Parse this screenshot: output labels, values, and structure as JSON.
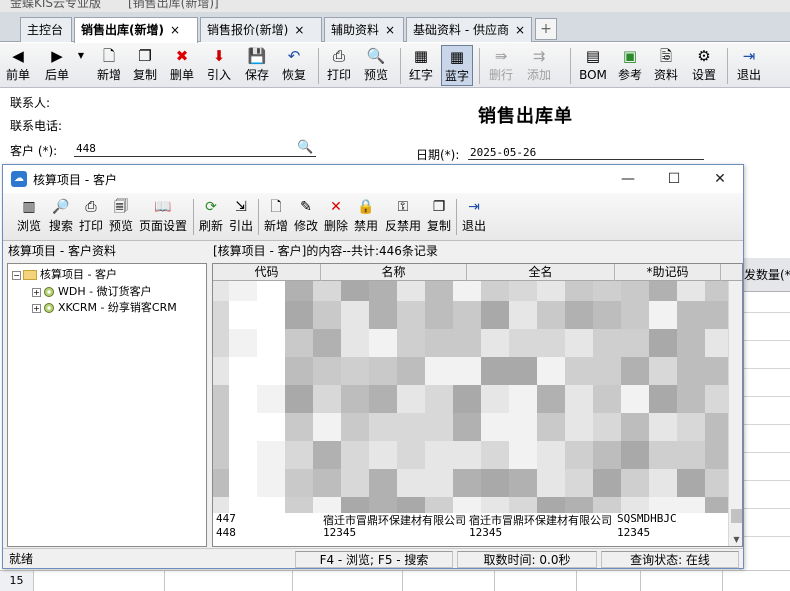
{
  "app": {
    "title_product": "金蝶KIS云专业版",
    "title_doc": "[销售出库(新增)]"
  },
  "tabs": [
    {
      "label": "主控台",
      "close": ""
    },
    {
      "label": "销售出库(新增)",
      "close": "×"
    },
    {
      "label": "销售报价(新增)",
      "close": "×"
    },
    {
      "label": "辅助资料",
      "close": "×"
    },
    {
      "label": "基础资料 - 供应商",
      "close": "×"
    }
  ],
  "tab_add": "+",
  "toolbar": {
    "prev": "前单",
    "next": "后单",
    "new": "新增",
    "copy": "复制",
    "delete": "删单",
    "import": "引入",
    "save": "保存",
    "restore": "恢复",
    "print": "打印",
    "preview": "预览",
    "red": "红字",
    "blue": "蓝字",
    "delrow": "删行",
    "addrow": "添加",
    "bom": "BOM",
    "ref": "参考",
    "data": "资料",
    "settings": "设置",
    "exit": "退出"
  },
  "form": {
    "title": "销售出库单",
    "contact_label": "联系人:",
    "phone_label": "联系电话:",
    "customer_label": "客户 (*):",
    "customer_value": "448",
    "date_label": "日期(*):",
    "date_value": "2025-05-26",
    "grid_col_partial": "发数量(*"
  },
  "bottom_row_number": "15",
  "dialog": {
    "title": "核算项目 - 客户",
    "min": "—",
    "max": "☐",
    "close": "✕",
    "toolbar": {
      "browse": "浏览",
      "search": "搜索",
      "print": "打印",
      "preview": "预览",
      "page_setup": "页面设置",
      "refresh": "刷新",
      "import": "引出",
      "new": "新增",
      "edit": "修改",
      "delete": "删除",
      "disable": "禁用",
      "enable": "反禁用",
      "copy": "复制",
      "exit": "退出"
    },
    "left_header": "核算项目 - 客户资料",
    "tree": {
      "root": "核算项目 - 客户",
      "child1": "WDH - 微订货客户",
      "child2": "XKCRM - 纷享销客CRM"
    },
    "right_header": "[核算项目 - 客户]的内容--共计:446条记录",
    "columns": [
      "代码",
      "名称",
      "全名",
      "*助记码"
    ],
    "rows": [
      {
        "code": "447",
        "name": "宿迁市冒鼎环保建材有限公司",
        "full": "宿迁市冒鼎环保建材有限公司",
        "memo": "SQSMDHBJC"
      },
      {
        "code": "448",
        "name": "12345",
        "full": "12345",
        "memo": "12345"
      }
    ],
    "status": {
      "ready": "就绪",
      "hint": "F4 - 浏览; F5 - 搜索",
      "fetch_time": "取数时间: 0.0秒",
      "query_status": "查询状态: 在线"
    }
  },
  "colors": {
    "accent": "#2e78d0",
    "tab_active_bg": "#ffffff",
    "dialog_border": "#6c8ebf"
  }
}
